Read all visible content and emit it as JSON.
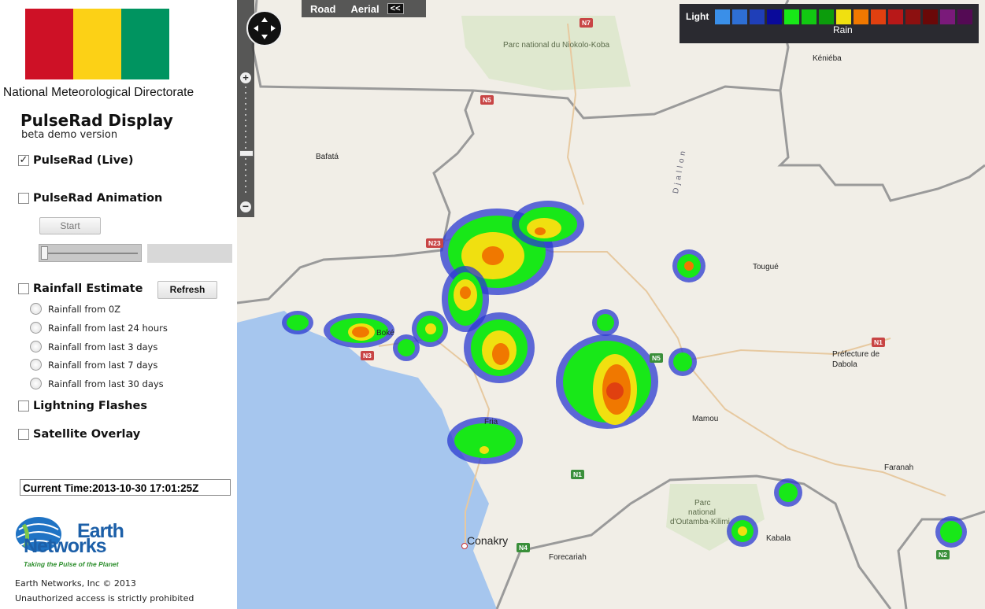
{
  "org": "National Meteorological Directorate",
  "flag_colors": [
    "#ce1126",
    "#fcd116",
    "#009460"
  ],
  "title": "PulseRad Display",
  "subtitle": "beta demo version",
  "options": {
    "live": {
      "label": "PulseRad (Live)",
      "checked": true
    },
    "animation": {
      "label": "PulseRad Animation",
      "checked": false
    },
    "rainfall": {
      "label": "Rainfall Estimate",
      "checked": false
    },
    "lightning": {
      "label": "Lightning Flashes",
      "checked": false
    },
    "satellite": {
      "label": "Satellite Overlay",
      "checked": false
    }
  },
  "start_label": "Start",
  "refresh_label": "Refresh",
  "rainfall_options": [
    "Rainfall from 0Z",
    "Rainfall from last 24 hours",
    "Rainfall from last 3 days",
    "Rainfall from last 7 days",
    "Rainfall from last 30 days"
  ],
  "current_time": "Current Time:2013-10-30 17:01:25Z",
  "logo": {
    "line1": "Earth",
    "line2": "Networks",
    "tagline": "Taking the Pulse of the Planet"
  },
  "copyright": "Earth Networks, Inc © 2013",
  "warning": "Unauthorized access is strictly prohibited",
  "map": {
    "tabs": {
      "road": "Road",
      "aerial": "Aerial",
      "collapse": "<<"
    },
    "legend": {
      "label": "Light",
      "title": "Rain",
      "colors": [
        "#3a8fe8",
        "#2e6fd4",
        "#1f3fb8",
        "#0a0a9a",
        "#18e818",
        "#12c812",
        "#0c9c0c",
        "#f0e010",
        "#f07800",
        "#e04010",
        "#b81818",
        "#8c1010",
        "#6a0808",
        "#7a1a7a",
        "#540a54"
      ]
    },
    "places": [
      {
        "name": "Parc national du Niokolo-Koba"
      },
      {
        "name": "Kéniéba"
      },
      {
        "name": "Bafatá"
      },
      {
        "name": "Tougué"
      },
      {
        "name": "Boké"
      },
      {
        "name": "Fria"
      },
      {
        "name": "Mamou"
      },
      {
        "name": "Préfecture de"
      },
      {
        "name": "Dabola"
      },
      {
        "name": "Faranah"
      },
      {
        "name": "Parc"
      },
      {
        "name": "national"
      },
      {
        "name": "d'Outamba-Kilimi"
      },
      {
        "name": "Kabala"
      },
      {
        "name": "Conakry"
      },
      {
        "name": "Forecariah"
      },
      {
        "name": "Djallon"
      }
    ],
    "roads": [
      "N7",
      "N5",
      "N23",
      "N3",
      "N5",
      "N1",
      "N1",
      "N4",
      "N2"
    ]
  }
}
